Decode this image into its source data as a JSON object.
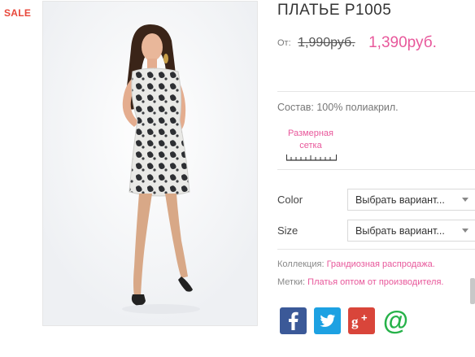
{
  "badge": {
    "sale": "SALE"
  },
  "product": {
    "title": "ПЛАТЬЕ Р1005",
    "price_from_label": "От:",
    "old_price": "1,990руб.",
    "new_price": "1,390руб.",
    "composition": "Состав: 100% полиакрил.",
    "size_chart_label": "Размерная сетка"
  },
  "options": [
    {
      "label": "Color",
      "placeholder": "Выбрать вариант..."
    },
    {
      "label": "Size",
      "placeholder": "Выбрать вариант..."
    }
  ],
  "meta": {
    "collection_label": "Коллекция:",
    "collection_value": "Грандиозная распродажа.",
    "tags_label": "Метки:",
    "tags_value": "Платья оптом от производителя."
  },
  "social": [
    {
      "icon": "facebook-icon",
      "color": "#3b5998"
    },
    {
      "icon": "twitter-icon",
      "color": "#1da1e2"
    },
    {
      "icon": "google-plus-icon",
      "color": "#d9453a"
    },
    {
      "icon": "email-at-icon",
      "color": "#27b24a"
    }
  ],
  "colors": {
    "accent": "#e8589b",
    "sale": "#e8483b"
  }
}
